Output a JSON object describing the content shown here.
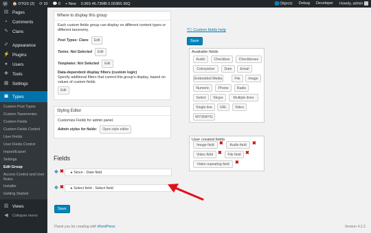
{
  "adminbar": {
    "site": "OTGS (2)",
    "updates": "10",
    "comments": "0",
    "new": "New",
    "stats": "0.36S 46.73MB 0.0038S 36Q",
    "objects": "Objects",
    "debug": "Debug",
    "developer": "Developer",
    "howdy": "Howdy, admin"
  },
  "sidebar": {
    "items": [
      {
        "label": "Pages"
      },
      {
        "label": "Comments"
      },
      {
        "label": "Clans"
      },
      {
        "label": "Appearance"
      },
      {
        "label": "Plugins"
      },
      {
        "label": "Users"
      },
      {
        "label": "Tools"
      },
      {
        "label": "Settings"
      },
      {
        "label": "Types"
      }
    ],
    "submenu": [
      {
        "label": "Custom Post Types"
      },
      {
        "label": "Custom Taxonomies"
      },
      {
        "label": "Custom Fields"
      },
      {
        "label": "Custom Fields Control"
      },
      {
        "label": "User Fields"
      },
      {
        "label": "User Fields Control"
      },
      {
        "label": "Import/Export"
      },
      {
        "label": "Settings"
      },
      {
        "label": "Edit Group"
      },
      {
        "label": "Access Control and User Roles"
      },
      {
        "label": "Installer"
      },
      {
        "label": "Getting Started"
      }
    ],
    "views": "Views",
    "collapse": "Collapse menu"
  },
  "display_box": {
    "title": "Where to display this group",
    "desc": "Each custom fields group can display on different content types or different taxonomy.",
    "post_types_label": "Post Types:",
    "post_types_value": "Clans",
    "terms_label": "Terms:",
    "terms_value": "Not Selected",
    "templates_label": "Templates:",
    "templates_value": "Not Selected",
    "edit": "Edit",
    "dd_title": "Data-dependent display filters (custom logic)",
    "dd_desc": "Specify additional filters that control this group's display, based on values of custom fields."
  },
  "styling_box": {
    "title": "Styling Editor",
    "desc": "Customize Fields for admin panel.",
    "admin_styles_label": "Admin styles for fields:",
    "open_button": "Open style editor"
  },
  "help_link": "Custom fields help",
  "save": "Save",
  "available": {
    "title": "Available fields",
    "fields": [
      "Audio",
      "Checkbox",
      "Checkboxes",
      "Colorpicker",
      "Date",
      "Email",
      "Embedded Media",
      "File",
      "Image",
      "Numeric",
      "Phone",
      "Radio",
      "Select",
      "Skype",
      "Multiple lines",
      "Single line",
      "URL",
      "Video",
      "WYSIWYG"
    ]
  },
  "user_created": {
    "title": "User created fields",
    "fields": [
      "Image field",
      "Audio field",
      "Video field",
      "File field",
      "Video repeating field"
    ]
  },
  "fields_section": {
    "title": "Fields",
    "rows": [
      "Since - Date field",
      "Select field - Select field"
    ]
  },
  "footer": {
    "thanks_prefix": "Thank you for creating with ",
    "thanks_link": "WordPress",
    "thanks_suffix": ".",
    "version": "Version 4.2.2"
  },
  "colors": {
    "accent": "#0073aa",
    "admin_bar": "#23282d",
    "delete": "#cc0000",
    "arrow": "#e0101a"
  }
}
